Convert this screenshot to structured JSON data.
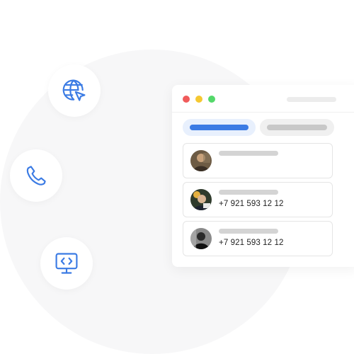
{
  "colors": {
    "accent": "#3b7be4",
    "window_red": "#f05b5b",
    "window_yellow": "#f5c831",
    "window_green": "#54d86a"
  },
  "icons": {
    "web": "globe-cursor-icon",
    "phone": "phone-icon",
    "code": "monitor-code-icon"
  },
  "window": {
    "tabs": [
      {
        "state": "active"
      },
      {
        "state": "inactive"
      }
    ],
    "contacts": [
      {
        "phone": ""
      },
      {
        "phone": "+7 921 593 12 12"
      },
      {
        "phone": "+7 921 593 12 12"
      }
    ]
  }
}
